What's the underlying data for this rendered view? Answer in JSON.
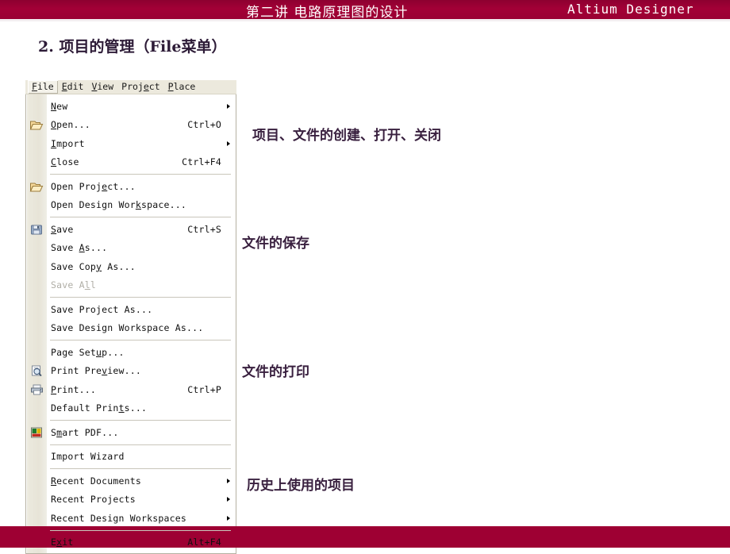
{
  "header": {
    "title": "第二讲  电路原理图的设计",
    "brand": "Altium Designer",
    "band_color": "#9e0033"
  },
  "section_heading": "2. 项目的管理（File菜单）",
  "menu_bar": {
    "items": [
      {
        "pre": "",
        "key": "F",
        "post": "ile",
        "active": true
      },
      {
        "pre": "",
        "key": "E",
        "post": "dit",
        "active": false
      },
      {
        "pre": "",
        "key": "V",
        "post": "iew",
        "active": false
      },
      {
        "pre": "Proj",
        "key": "e",
        "post": "ct",
        "active": false
      },
      {
        "pre": "",
        "key": "P",
        "post": "lace",
        "active": false
      }
    ]
  },
  "file_menu": {
    "items": [
      {
        "type": "item",
        "pre": "",
        "key": "N",
        "post": "ew",
        "label": "New",
        "accel": "",
        "arrow": true,
        "icon": "",
        "disabled": false
      },
      {
        "type": "item",
        "pre": "",
        "key": "O",
        "post": "pen...",
        "label": "Open...",
        "accel": "Ctrl+O",
        "arrow": false,
        "icon": "open-folder-icon",
        "disabled": false
      },
      {
        "type": "item",
        "pre": "",
        "key": "I",
        "post": "mport",
        "label": "Import",
        "accel": "",
        "arrow": true,
        "icon": "",
        "disabled": false
      },
      {
        "type": "item",
        "pre": "",
        "key": "C",
        "post": "lose",
        "label": "Close",
        "accel": "Ctrl+F4",
        "arrow": false,
        "icon": "",
        "disabled": false
      },
      {
        "type": "separator"
      },
      {
        "type": "item",
        "pre": "Open Proj",
        "key": "e",
        "post": "ct...",
        "label": "Open Project...",
        "accel": "",
        "arrow": false,
        "icon": "open-folder-icon",
        "disabled": false
      },
      {
        "type": "item",
        "pre": "Open Design Wor",
        "key": "k",
        "post": "space...",
        "label": "Open Design Workspace...",
        "accel": "",
        "arrow": false,
        "icon": "",
        "disabled": false
      },
      {
        "type": "separator"
      },
      {
        "type": "item",
        "pre": "",
        "key": "S",
        "post": "ave",
        "label": "Save",
        "accel": "Ctrl+S",
        "arrow": false,
        "icon": "save-disk-icon",
        "disabled": false
      },
      {
        "type": "item",
        "pre": "Save ",
        "key": "A",
        "post": "s...",
        "label": "Save As...",
        "accel": "",
        "arrow": false,
        "icon": "",
        "disabled": false
      },
      {
        "type": "item",
        "pre": "Save Cop",
        "key": "y",
        "post": " As...",
        "label": "Save Copy As...",
        "accel": "",
        "arrow": false,
        "icon": "",
        "disabled": false
      },
      {
        "type": "item",
        "pre": "Save A",
        "key": "l",
        "post": "l",
        "label": "Save All",
        "accel": "",
        "arrow": false,
        "icon": "",
        "disabled": true
      },
      {
        "type": "separator"
      },
      {
        "type": "item",
        "pre": "Save Project As...",
        "key": "",
        "post": "",
        "label": "Save Project As...",
        "accel": "",
        "arrow": false,
        "icon": "",
        "disabled": false
      },
      {
        "type": "item",
        "pre": "Save Design Workspace As...",
        "key": "",
        "post": "",
        "label": "Save Design Workspace As...",
        "accel": "",
        "arrow": false,
        "icon": "",
        "disabled": false
      },
      {
        "type": "separator"
      },
      {
        "type": "item",
        "pre": "Page Set",
        "key": "u",
        "post": "p...",
        "label": "Page Setup...",
        "accel": "",
        "arrow": false,
        "icon": "",
        "disabled": false
      },
      {
        "type": "item",
        "pre": "Print Pre",
        "key": "v",
        "post": "iew...",
        "label": "Print Preview...",
        "accel": "",
        "arrow": false,
        "icon": "print-preview-icon",
        "disabled": false
      },
      {
        "type": "item",
        "pre": "",
        "key": "P",
        "post": "rint...",
        "label": "Print...",
        "accel": "Ctrl+P",
        "arrow": false,
        "icon": "printer-icon",
        "disabled": false
      },
      {
        "type": "item",
        "pre": "Default Prin",
        "key": "t",
        "post": "s...",
        "label": "Default Prints...",
        "accel": "",
        "arrow": false,
        "icon": "",
        "disabled": false
      },
      {
        "type": "separator"
      },
      {
        "type": "item",
        "pre": "S",
        "key": "m",
        "post": "art PDF...",
        "label": "Smart PDF...",
        "accel": "",
        "arrow": false,
        "icon": "smart-pdf-icon",
        "disabled": false
      },
      {
        "type": "separator"
      },
      {
        "type": "item",
        "pre": "Import Wizard",
        "key": "",
        "post": "",
        "label": "Import Wizard",
        "accel": "",
        "arrow": false,
        "icon": "",
        "disabled": false
      },
      {
        "type": "separator"
      },
      {
        "type": "item",
        "pre": "",
        "key": "R",
        "post": "ecent Documents",
        "label": "Recent Documents",
        "accel": "",
        "arrow": true,
        "icon": "",
        "disabled": false
      },
      {
        "type": "item",
        "pre": "Recent Projects",
        "key": "",
        "post": "",
        "label": "Recent Projects",
        "accel": "",
        "arrow": true,
        "icon": "",
        "disabled": false
      },
      {
        "type": "item",
        "pre": "Recent Design Workspaces",
        "key": "",
        "post": "",
        "label": "Recent Design Workspaces",
        "accel": "",
        "arrow": true,
        "icon": "",
        "disabled": false
      },
      {
        "type": "separator"
      },
      {
        "type": "item",
        "pre": "E",
        "key": "x",
        "post": "it",
        "label": "Exit",
        "accel": "Alt+F4",
        "arrow": false,
        "icon": "",
        "disabled": false
      }
    ]
  },
  "annotations": [
    {
      "text": "项目、文件的创建、打开、关闭"
    },
    {
      "text": "文件的保存"
    },
    {
      "text": "文件的打印"
    },
    {
      "text": "历史上使用的项目"
    }
  ]
}
